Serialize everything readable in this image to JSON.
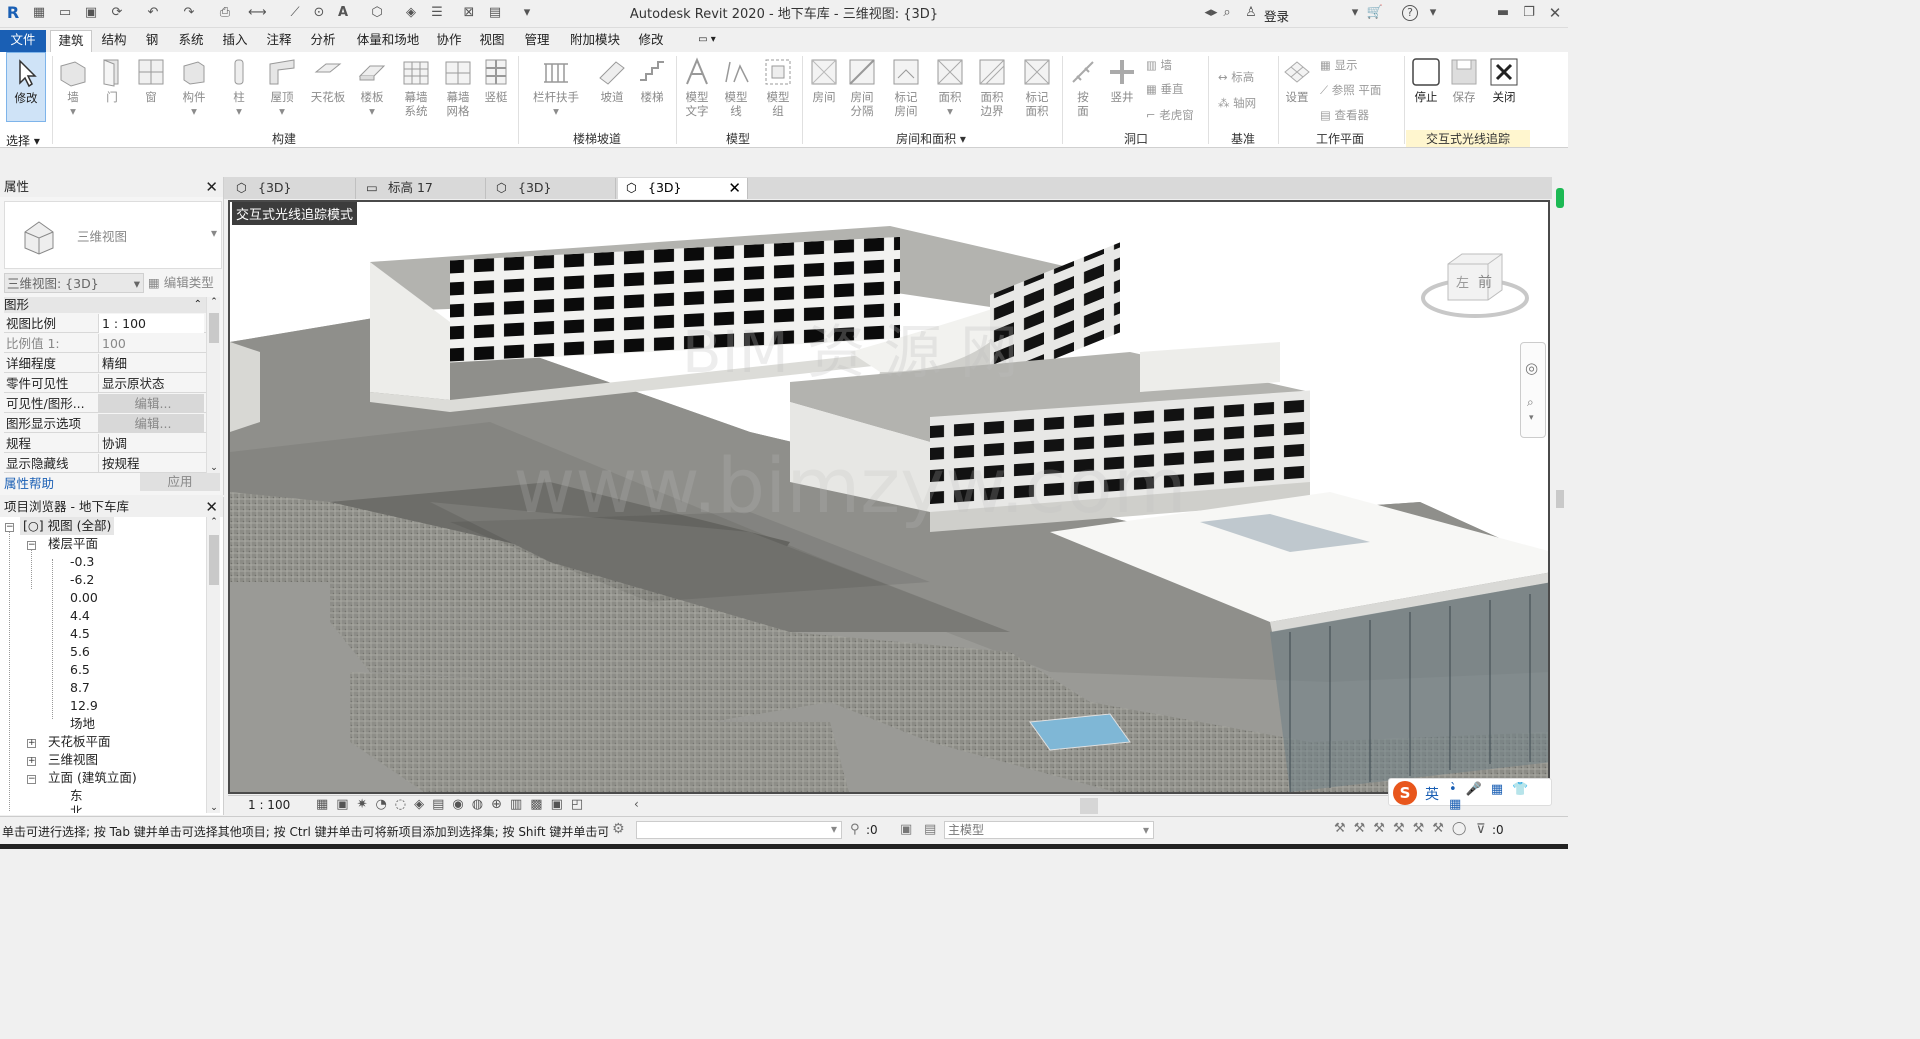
{
  "app": {
    "title": "Autodesk Revit 2020 - 地下车库 - 三维视图: {3D}",
    "login": "登录"
  },
  "ribbon_tabs": [
    "文件",
    "建筑",
    "结构",
    "钢",
    "系统",
    "插入",
    "注释",
    "分析",
    "体量和场地",
    "协作",
    "视图",
    "管理",
    "附加模块",
    "修改"
  ],
  "ribbon": {
    "modify": "修改",
    "select": "选择",
    "build": [
      "墙",
      "门",
      "窗",
      "构件",
      "柱",
      "屋顶",
      "天花板",
      "楼板",
      "幕墙系统",
      "幕墙网格",
      "竖梃"
    ],
    "build_label": "构建",
    "stair": [
      "栏杆扶手",
      "坡道",
      "楼梯"
    ],
    "stair_label": "楼梯坡道",
    "model": [
      "模型文字",
      "模型线",
      "模型组"
    ],
    "model_label": "模型",
    "room": [
      "房间",
      "房间分隔",
      "标记房间",
      "面积",
      "面积边界",
      "标记面积"
    ],
    "room_label": "房间和面积",
    "opening": [
      "按面",
      "竖井"
    ],
    "opening_small": [
      "墙",
      "垂直",
      "老虎窗"
    ],
    "opening_label": "洞口",
    "datum_small": [
      "标高",
      "轴网"
    ],
    "datum_label": "基准",
    "workplane_set": "设置",
    "workplane_small": [
      "显示",
      "参照 平面",
      "查看器"
    ],
    "workplane_label": "工作平面",
    "raytrace": [
      "停止",
      "保存",
      "关闭"
    ],
    "raytrace_label": "交互式光线追踪"
  },
  "properties": {
    "title": "属性",
    "type_name": "三维视图",
    "selector": "三维视图: {3D}",
    "edit_type": "编辑类型",
    "group": "图形",
    "rows": [
      {
        "k": "视图比例",
        "v": "1 : 100"
      },
      {
        "k": "比例值 1:",
        "v": "100"
      },
      {
        "k": "详细程度",
        "v": "精细"
      },
      {
        "k": "零件可见性",
        "v": "显示原状态"
      },
      {
        "k": "可见性/图形...",
        "v": "编辑..."
      },
      {
        "k": "图形显示选项",
        "v": "编辑..."
      },
      {
        "k": "规程",
        "v": "协调"
      },
      {
        "k": "显示隐藏线",
        "v": "按规程"
      }
    ],
    "help": "属性帮助",
    "apply": "应用"
  },
  "browser": {
    "title": "项目浏览器 - 地下车库",
    "root": "视图 (全部)",
    "floor_plans": "楼层平面",
    "levels": [
      "-0.3",
      "-6.2",
      "0.00",
      "4.4",
      "4.5",
      "5.6",
      "6.5",
      "8.7",
      "12.9",
      "场地"
    ],
    "ceiling": "天花板平面",
    "views3d": "三维视图",
    "elevations": "立面 (建筑立面)",
    "elev_items": [
      "东",
      "北"
    ]
  },
  "view_tabs": [
    "{3D}",
    "标高 17",
    "{3D}",
    "{3D}"
  ],
  "viewport": {
    "mode": "交互式光线追踪模式",
    "watermark": "BIM资源网 www.bimzyw.com",
    "cube_left": "左",
    "cube_front": "前"
  },
  "viewbar": {
    "scale": "1 : 100"
  },
  "status": {
    "hint": "单击可进行选择; 按 Tab 键并单击可选择其他项目; 按 Ctrl 键并单击可将新项目添加到选择集; 按 Shift 键并单击可",
    "count": ":0",
    "model": "主模型",
    "filter": ":0"
  },
  "ime": {
    "lang": "英"
  },
  "colors": {
    "file_tab": "#1a5fb4",
    "accent": "#e8561c"
  }
}
